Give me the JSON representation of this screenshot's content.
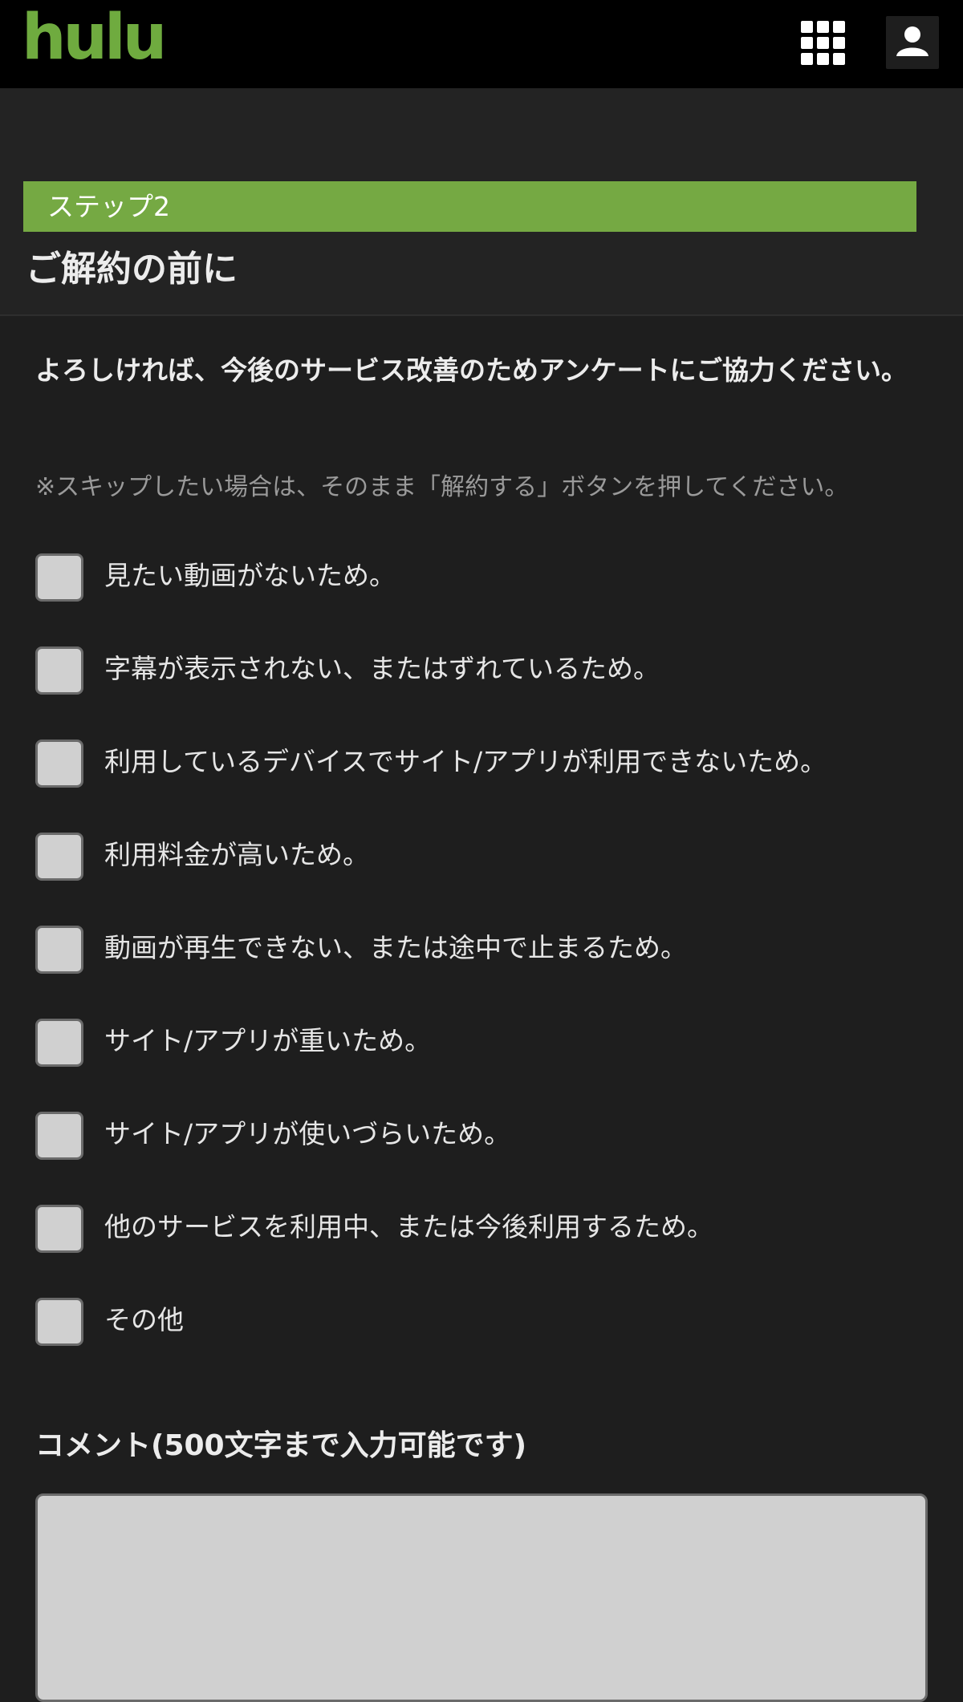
{
  "header": {
    "logo_text": "hulu",
    "logo_color": "#6fab3f",
    "apps_icon": "grid-icon",
    "account_icon": "user-icon"
  },
  "step": {
    "label": "ステップ2",
    "color": "#75a943"
  },
  "page": {
    "title": "ご解約の前に"
  },
  "survey": {
    "intro": "よろしければ、今後のサービス改善のためアンケートにご協力ください。",
    "note": "※スキップしたい場合は、そのまま「解約する」ボタンを押してください。",
    "options": [
      {
        "label": "見たい動画がないため。",
        "checked": false
      },
      {
        "label": "字幕が表示されない、またはずれているため。",
        "checked": false
      },
      {
        "label": "利用しているデバイスでサイト/アプリが利用できないため。",
        "checked": false
      },
      {
        "label": "利用料金が高いため。",
        "checked": false
      },
      {
        "label": "動画が再生できない、または途中で止まるため。",
        "checked": false
      },
      {
        "label": "サイト/アプリが重いため。",
        "checked": false
      },
      {
        "label": "サイト/アプリが使いづらいため。",
        "checked": false
      },
      {
        "label": "他のサービスを利用中、または今後利用するため。",
        "checked": false
      },
      {
        "label": "その他",
        "checked": false
      }
    ]
  },
  "comment": {
    "label": "コメント(500文字まで入力可能です)",
    "value": ""
  }
}
